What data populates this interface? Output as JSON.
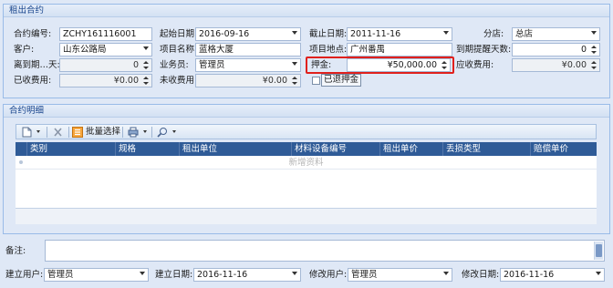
{
  "contract_section": {
    "title": "租出合约",
    "contract_no_label": "合约编号:",
    "contract_no": "ZCHY161116001",
    "start_date_label": "起始日期:",
    "start_date": "2016-09-16",
    "end_date_label": "截止日期:",
    "end_date": "2011-11-16",
    "store_label": "分店:",
    "store": "总店",
    "customer_label": "客户:",
    "customer": "山东公路局",
    "project_name_label": "项目名称:",
    "project_name": "蓝格大厦",
    "project_location_label": "项目地点:",
    "project_location": "广州番禺",
    "reminder_days_label": "到期提醒天数:",
    "reminder_days": "0",
    "days_left_label": "离到期…天:",
    "days_left": "0",
    "salesman_label": "业务员:",
    "salesman": "管理员",
    "deposit_label": "押金:",
    "deposit": "¥50,000.00",
    "receivable_label": "应收费用:",
    "receivable": "¥0.00",
    "received_label": "已收费用:",
    "received": "¥0.00",
    "unreceived_label": "未收费用:",
    "unreceived": "¥0.00",
    "deposit_refunded_label": "已退押金",
    "deposit_refunded": false
  },
  "details_section": {
    "title": "合约明细",
    "toolbar": {
      "batch_select_label": "批量选择"
    },
    "columns": [
      "类别",
      "规格",
      "租出单位",
      "材料设备编号",
      "租出单价",
      "丢损类型",
      "赔偿单价"
    ],
    "new_row_placeholder": "新增资料",
    "rows": []
  },
  "remarks": {
    "label": "备注:",
    "value": ""
  },
  "footer": {
    "created_by_label": "建立用户:",
    "created_by": "管理员",
    "created_date_label": "建立日期:",
    "created_date": "2016-11-16",
    "modified_by_label": "修改用户:",
    "modified_by": "管理员",
    "modified_date_label": "修改日期:",
    "modified_date": "2016-11-16"
  },
  "colors": {
    "header_bg": "#2f5b97",
    "panel_bg": "#dfe8f6",
    "highlight_border": "#e0201c",
    "group_title": "#15428b"
  }
}
